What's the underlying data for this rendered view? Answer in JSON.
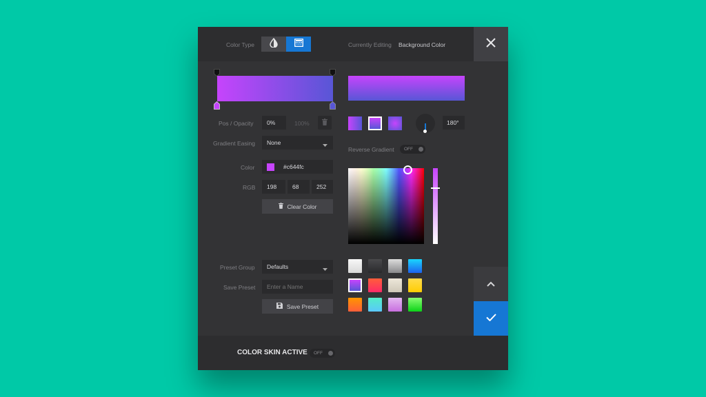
{
  "header": {
    "color_type_label": "Color Type",
    "editing_label": "Currently Editing",
    "editing_value": "Background Color"
  },
  "gradient": {
    "start_color": "#c644fc",
    "end_color": "#5856d6",
    "pos_opacity_label": "Pos / Opacity",
    "position": "0%",
    "opacity": "100%",
    "easing_label": "Gradient Easing",
    "easing_value": "None",
    "reverse_label": "Reverse Gradient",
    "reverse_state": "OFF",
    "angle": "180°"
  },
  "color": {
    "label": "Color",
    "hex": "#c644fc",
    "rgb_label": "RGB",
    "r": "198",
    "g": "68",
    "b": "252",
    "clear_label": "Clear Color"
  },
  "presets": {
    "group_label": "Preset Group",
    "group_value": "Defaults",
    "save_label": "Save Preset",
    "name_placeholder": "Enter a Name",
    "save_button": "Save Preset"
  },
  "footer": {
    "skin_label": "COLOR SKIN ACTIVE",
    "skin_state": "OFF"
  }
}
